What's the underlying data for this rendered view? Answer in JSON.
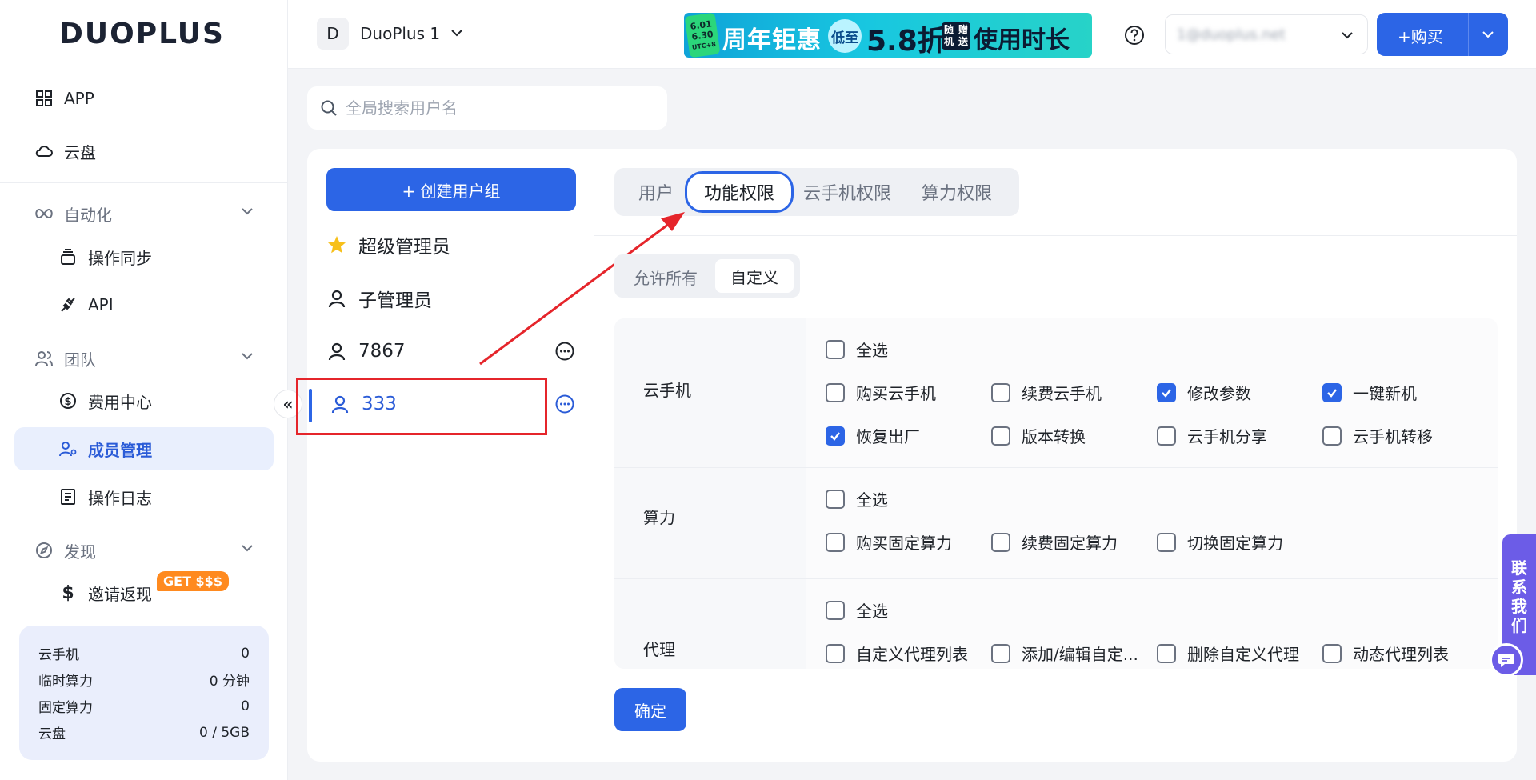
{
  "brand": {
    "logo_text": "DUOPLUS"
  },
  "sidebar": {
    "top_items": [
      {
        "label": "APP",
        "icon": "grid-icon"
      },
      {
        "label": "云盘",
        "icon": "cloud-icon"
      }
    ],
    "automation": {
      "label": "自动化",
      "items": [
        {
          "label": "操作同步",
          "icon": "stack-icon"
        },
        {
          "label": "API",
          "icon": "plug-icon"
        }
      ]
    },
    "team": {
      "label": "团队",
      "items": [
        {
          "label": "费用中心",
          "icon": "dollar-circle-icon"
        },
        {
          "label": "成员管理",
          "icon": "users-icon"
        },
        {
          "label": "操作日志",
          "icon": "log-icon"
        }
      ]
    },
    "discover": {
      "label": "发现",
      "items": [
        {
          "label": "邀请返现",
          "icon": "dollar-icon"
        }
      ],
      "badge": "GET $$$"
    },
    "usage": [
      {
        "label": "云手机",
        "value": "0"
      },
      {
        "label": "临时算力",
        "value": "0 分钟"
      },
      {
        "label": "固定算力",
        "value": "0"
      },
      {
        "label": "云盘",
        "value": "0 / 5GB"
      }
    ]
  },
  "topbar": {
    "workspace_initial": "D",
    "workspace_name": "DuoPlus 1",
    "banner": {
      "date_line1": "6.01",
      "date_line2": "6.30",
      "date_line3": "UTC+8",
      "title": "周年钜惠",
      "low": "低至",
      "discount": "5.8折",
      "gift_line1": "随机",
      "gift_line2": "赠送",
      "tail": "使用时长"
    },
    "account_placeholder": "1@duoplus.net",
    "buy_label": "+购买"
  },
  "search": {
    "placeholder": "全局搜索用户名"
  },
  "groups": {
    "create_label": "+ 创建用户组",
    "items": [
      {
        "label": "超级管理员",
        "icon": "star-icon"
      },
      {
        "label": "子管理员",
        "icon": "user-icon"
      },
      {
        "label": "7867",
        "icon": "user-icon"
      },
      {
        "label": "333",
        "icon": "user-icon"
      }
    ]
  },
  "tabs": [
    "用户",
    "功能权限",
    "云手机权限",
    "算力权限"
  ],
  "mode": {
    "all": "允许所有",
    "custom": "自定义"
  },
  "permissions": {
    "select_all": "全选",
    "cloud_phone": {
      "label": "云手机",
      "items": [
        {
          "label": "购买云手机",
          "checked": false
        },
        {
          "label": "续费云手机",
          "checked": false
        },
        {
          "label": "修改参数",
          "checked": true
        },
        {
          "label": "一键新机",
          "checked": true
        },
        {
          "label": "恢复出厂",
          "checked": true
        },
        {
          "label": "版本转换",
          "checked": false
        },
        {
          "label": "云手机分享",
          "checked": false
        },
        {
          "label": "云手机转移",
          "checked": false
        }
      ]
    },
    "compute": {
      "label": "算力",
      "items": [
        {
          "label": "购买固定算力",
          "checked": false
        },
        {
          "label": "续费固定算力",
          "checked": false
        },
        {
          "label": "切换固定算力",
          "checked": false
        }
      ]
    },
    "proxy": {
      "label": "代理",
      "items": [
        {
          "label": "自定义代理列表",
          "checked": false
        },
        {
          "label": "添加/编辑自定...",
          "checked": false
        },
        {
          "label": "删除自定义代理",
          "checked": false
        },
        {
          "label": "动态代理列表",
          "checked": false
        }
      ]
    }
  },
  "confirm_label": "确定",
  "contact": {
    "line1": "联",
    "line2": "系",
    "line3": "我",
    "line4": "们"
  },
  "colors": {
    "accent": "#2c65e6",
    "annotation_red": "#e5252b"
  }
}
